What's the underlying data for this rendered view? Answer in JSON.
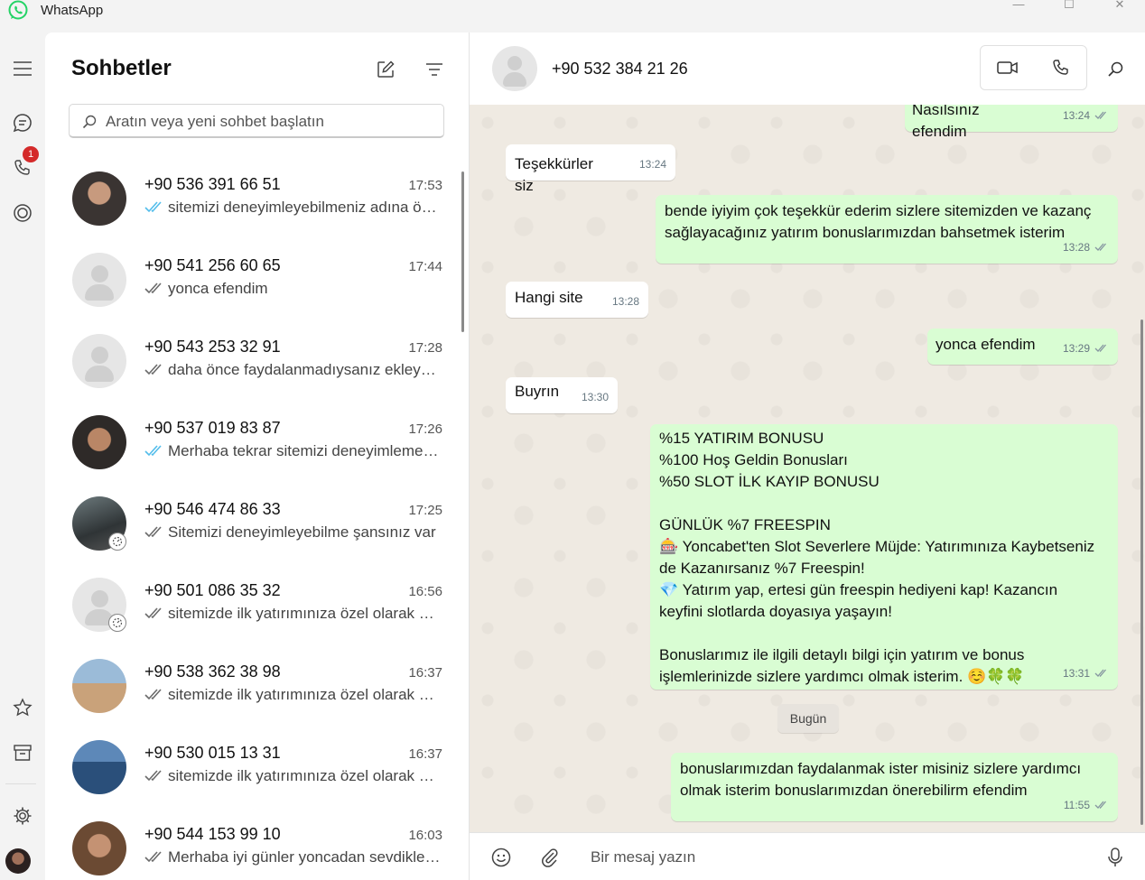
{
  "app": {
    "title": "WhatsApp"
  },
  "window_controls": {
    "minimize": "—",
    "maximize": "☐",
    "close": "✕"
  },
  "rail": {
    "calls_badge": "1"
  },
  "sidebar": {
    "title": "Sohbetler",
    "search_placeholder": "Aratın veya yeni sohbet başlatın",
    "chats": [
      {
        "name": "+90 536 391 66 51",
        "time": "17:53",
        "preview": "sitemizi deneyimleyebilmeniz adına özel bir fırsat sunuyoruz",
        "tick": "read",
        "avatar": "photo"
      },
      {
        "name": "+90 541 256 60 65",
        "time": "17:44",
        "preview": "yonca efendim",
        "tick": "delivered",
        "avatar": "generic"
      },
      {
        "name": "+90 543 253 32 91",
        "time": "17:28",
        "preview": "daha önce faydalanmadıysanız ekleyebiliriz",
        "tick": "delivered",
        "avatar": "generic"
      },
      {
        "name": "+90 537 019 83 87",
        "time": "17:26",
        "preview": "Merhaba tekrar sitemizi deneyimlemek ister misiniz",
        "tick": "read",
        "avatar": "photo"
      },
      {
        "name": "+90 546 474 86 33",
        "time": "17:25",
        "preview": "Sitemizi deneyimleyebilme şansınız var",
        "tick": "delivered",
        "avatar": "photo",
        "status": true
      },
      {
        "name": "+90 501 086 35 32",
        "time": "16:56",
        "preview": "sitemizde ilk yatırımınıza özel olarak bonus",
        "tick": "delivered",
        "avatar": "generic",
        "status": true
      },
      {
        "name": "+90 538 362 38 98",
        "time": "16:37",
        "preview": "sitemizde ilk yatırımınıza özel olarak bonus",
        "tick": "delivered",
        "avatar": "photo"
      },
      {
        "name": "+90 530 015 13 31",
        "time": "16:37",
        "preview": "sitemizde ilk yatırımınıza özel olarak bonus",
        "tick": "delivered",
        "avatar": "photo"
      },
      {
        "name": "+90 544 153 99 10",
        "time": "16:03",
        "preview": "Merhaba iyi günler yoncadan sevdiklerinize",
        "tick": "delivered",
        "avatar": "photo"
      }
    ]
  },
  "chat": {
    "contact": "+90 532 384 21 26",
    "day_separator": "Bugün",
    "composer_placeholder": "Bir mesaj yazın",
    "messages": [
      {
        "dir": "out",
        "text": "Nasılsınız efendim",
        "time": "13:24"
      },
      {
        "dir": "in",
        "text": "Teşekkürler siz",
        "time": "13:24"
      },
      {
        "dir": "out",
        "text": "bende iyiyim çok teşekkür ederim sizlere sitemizden ve kazanç\nsağlayacağınız yatırım bonuslarımızdan bahsetmek isterim",
        "time": "13:28"
      },
      {
        "dir": "in",
        "text": "Hangi site",
        "time": "13:28"
      },
      {
        "dir": "out",
        "text": "yonca efendim",
        "time": "13:29"
      },
      {
        "dir": "in",
        "text": "Buyrın",
        "time": "13:30"
      },
      {
        "dir": "out",
        "text": "%15 YATIRIM BONUSU\n%100 Hoş Geldin Bonusları\n%50 SLOT İLK KAYIP BONUSU\n\nGÜNLÜK %7 FREESPIN\n🎰 Yoncabet'ten Slot Severlere Müjde: Yatırımınıza Kaybetseniz\nde Kazanırsanız %7 Freespin!\n💎 Yatırım yap, ertesi gün freespin hediyeni kap! Kazancın\nkeyfini slotlarda doyasıya yaşayın!\n\nBonuslarımız ile ilgili detaylı bilgi için yatırım ve bonus\nişlemlerinizde sizlere yardımcı olmak isterim. ☺️🍀🍀",
        "time": "13:31"
      },
      {
        "dir": "out",
        "text": "bonuslarımızdan faydalanmak ister misiniz sizlere yardımcı\nolmak isterim bonuslarımızdan önerebilirm efendim",
        "time": "11:55"
      }
    ]
  },
  "colors": {
    "accent": "#25d366",
    "out_bubble": "#d9fdd3",
    "read_tick": "#53bdeb",
    "badge": "#d42a2a"
  }
}
